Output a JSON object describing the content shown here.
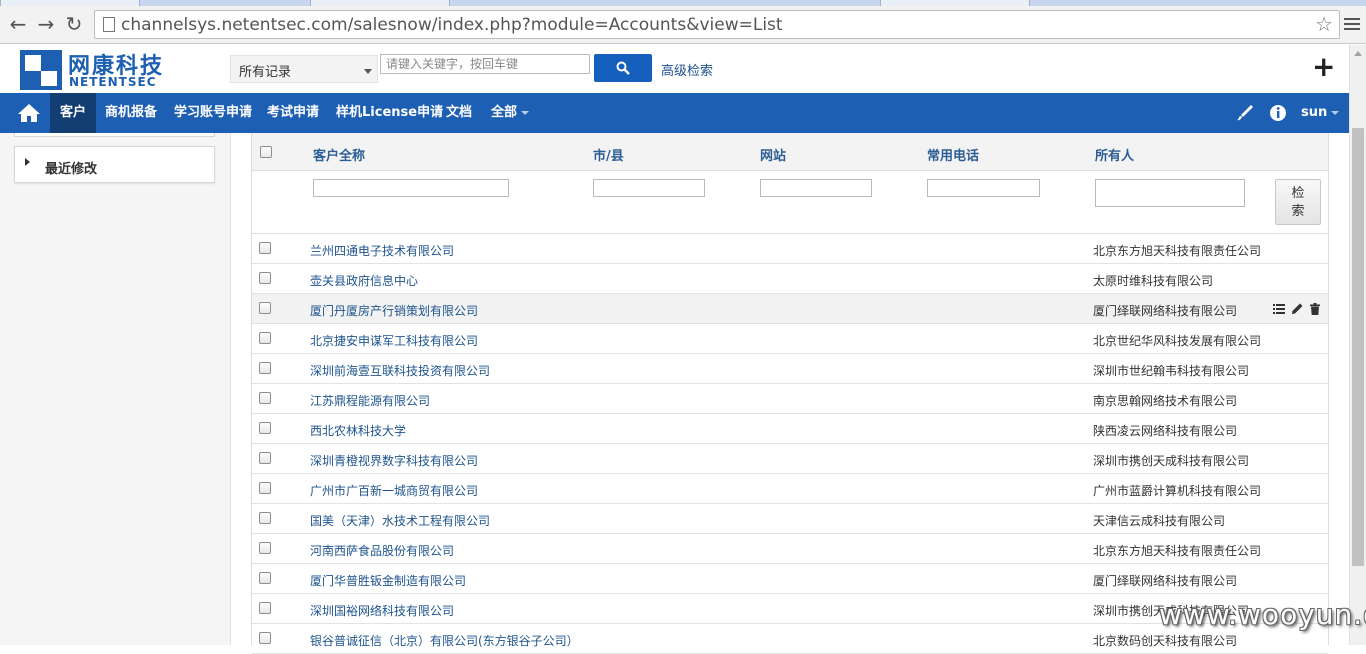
{
  "browser": {
    "url": "channelsys.netentsec.com/salesnow/index.php?module=Accounts&view=List"
  },
  "header": {
    "logo_cn": "网康科技",
    "logo_en": "NETENTSEC",
    "scope_selected": "所有记录",
    "search_placeholder": "请键入关键字，按回车键",
    "advanced_search": "高级检索"
  },
  "nav": {
    "items": [
      "客户",
      "商机报备",
      "学习账号申请",
      "考试申请",
      "样机License申请",
      "文档",
      "全部"
    ],
    "active": "客户",
    "user": "sun"
  },
  "sidebar": {
    "recent_label": "最近修改"
  },
  "list": {
    "columns": [
      "客户全称",
      "市/县",
      "网站",
      "常用电话",
      "所有人"
    ],
    "search_button": "检\n索",
    "rows": [
      {
        "name": "兰州四通电子技术有限公司",
        "owner": "北京东方旭天科技有限责任公司"
      },
      {
        "name": "壶关县政府信息中心",
        "owner": "太原时维科技有限公司"
      },
      {
        "name": "厦门丹厦房产行销策划有限公司",
        "owner": "厦门绎联网络科技有限公司"
      },
      {
        "name": "北京捷安申谋军工科技有限公司",
        "owner": "北京世纪华风科技发展有限公司"
      },
      {
        "name": "深圳前海壹互联科技投资有限公司",
        "owner": "深圳市世纪翰韦科技有限公司"
      },
      {
        "name": "江苏鼎程能源有限公司",
        "owner": "南京思翰网络技术有限公司"
      },
      {
        "name": "西北农林科技大学",
        "owner": "陕西凌云网络科技有限公司"
      },
      {
        "name": "深圳青橙视界数字科技有限公司",
        "owner": "深圳市携创天成科技有限公司"
      },
      {
        "name": "广州市广百新一城商贸有限公司",
        "owner": "广州市蓝爵计算机科技有限公司"
      },
      {
        "name": "国美（天津）水技术工程有限公司",
        "owner": "天津信云成科技有限公司"
      },
      {
        "name": "河南西萨食品股份有限公司",
        "owner": "北京东方旭天科技有限责任公司"
      },
      {
        "name": "厦门华普胜钣金制造有限公司",
        "owner": "厦门绎联网络科技有限公司"
      },
      {
        "name": "深圳国裕网络科技有限公司",
        "owner": "深圳市携创天成科技有限公司"
      },
      {
        "name": "银谷普诚征信（北京）有限公司(东方银谷子公司）",
        "owner": "北京数码创天科技有限公司"
      }
    ]
  },
  "watermark": "www.wooyun.org",
  "colors": {
    "navbar": "#1d5fb3",
    "nav_active": "#123e73",
    "link": "#1e548f",
    "search_button": "#1560bd"
  }
}
